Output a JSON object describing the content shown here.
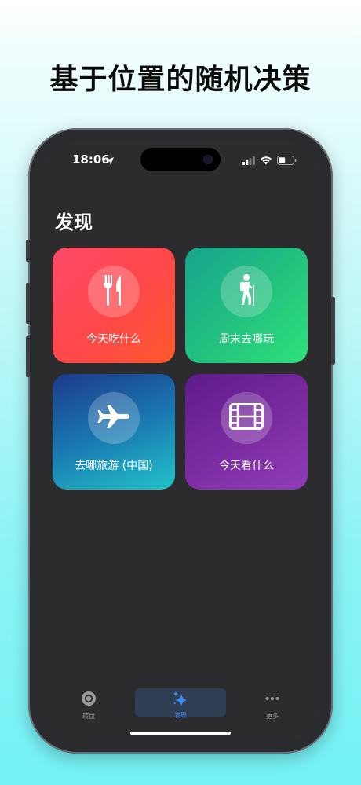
{
  "headline": "基于位置的随机决策",
  "status_bar": {
    "time": "18:06"
  },
  "page_title": "发现",
  "cards": [
    {
      "label": "今天吃什么",
      "icon": "fork-knife-icon",
      "color_from": "#ff4a6a",
      "color_to": "#ff5a2e"
    },
    {
      "label": "周末去哪玩",
      "icon": "hiking-icon",
      "color_from": "#17a38e",
      "color_to": "#2fe27a"
    },
    {
      "label": "去哪旅游 (中国)",
      "icon": "airplane-icon",
      "color_from": "#1c3a8c",
      "color_to": "#22c4c9"
    },
    {
      "label": "今天看什么",
      "icon": "film-icon",
      "color_from": "#5d1b8a",
      "color_to": "#8f3db8"
    }
  ],
  "tabbar": {
    "items": [
      {
        "label": "转盘",
        "icon": "wheel-icon"
      },
      {
        "label": "发现",
        "icon": "sparkles-icon",
        "selected": true
      },
      {
        "label": "更多",
        "icon": "ellipsis-icon"
      }
    ],
    "accent": "#3a8dff"
  }
}
